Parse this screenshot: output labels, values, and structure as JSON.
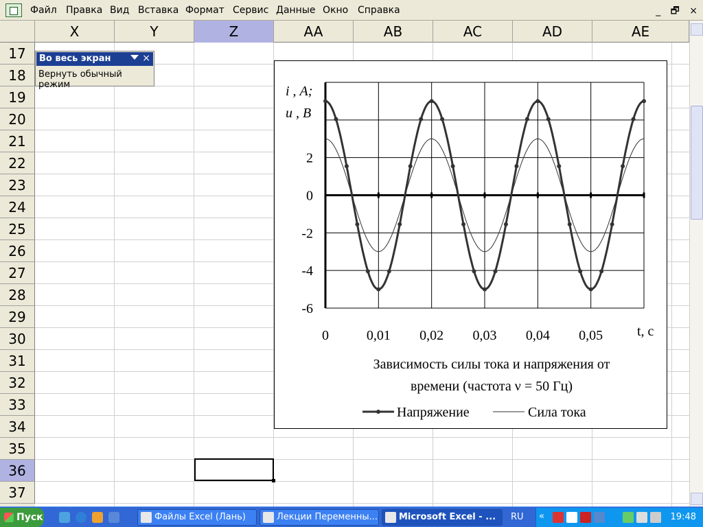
{
  "menu": [
    "Файл",
    "Правка",
    "Вид",
    "Вставка",
    "Формат",
    "Сервис",
    "Данные",
    "Окно",
    "Справка"
  ],
  "window_controls": {
    "minimize": "_",
    "restore": "🗗",
    "close": "×"
  },
  "columns": [
    {
      "label": "X",
      "selected": false
    },
    {
      "label": "Y",
      "selected": false
    },
    {
      "label": "Z",
      "selected": true
    },
    {
      "label": "AA",
      "selected": false
    },
    {
      "label": "AB",
      "selected": false
    },
    {
      "label": "AC",
      "selected": false
    },
    {
      "label": "AD",
      "selected": false
    },
    {
      "label": "AE",
      "selected": false
    }
  ],
  "rows": [
    "17",
    "18",
    "19",
    "20",
    "21",
    "22",
    "23",
    "24",
    "25",
    "26",
    "27",
    "28",
    "29",
    "30",
    "31",
    "32",
    "33",
    "34",
    "35",
    "36",
    "37"
  ],
  "selected_row": "36",
  "fullscreen_toolbar": {
    "title": "Во весь экран",
    "close": "×",
    "button": "Вернуть обычный режим"
  },
  "chart_data": {
    "type": "line",
    "ylabel_line1": "i , А;",
    "ylabel_line2": "u , В",
    "xlabel": "t, с",
    "title_line1": "Зависимость силы тока и напряжения от",
    "title_line2": "времени (частота ν  = 50 Гц)",
    "ylim": [
      -6,
      6
    ],
    "xlim": [
      0,
      0.06
    ],
    "yticks": [
      {
        "value": -6,
        "label": "-6"
      },
      {
        "value": -4,
        "label": "-4"
      },
      {
        "value": -2,
        "label": "-2"
      },
      {
        "value": 0,
        "label": "0"
      },
      {
        "value": 2,
        "label": "2"
      }
    ],
    "xticks": [
      {
        "value": 0,
        "label": "0"
      },
      {
        "value": 0.01,
        "label": "0,01"
      },
      {
        "value": 0.02,
        "label": "0,02"
      },
      {
        "value": 0.03,
        "label": "0,03"
      },
      {
        "value": 0.04,
        "label": "0,04"
      },
      {
        "value": 0.05,
        "label": "0,05"
      }
    ],
    "series": [
      {
        "name": "Напряжение",
        "amplitude": 5,
        "frequency_hz": 50,
        "markers": true,
        "color": "#333333"
      },
      {
        "name": "Сила тока",
        "amplitude": 3,
        "frequency_hz": 50,
        "markers": false,
        "color": "#333333"
      }
    ]
  },
  "taskbar": {
    "start": "Пуск",
    "tasks": [
      {
        "label": "Файлы Excel (Лань)",
        "active": false
      },
      {
        "label": "Лекции Переменны...",
        "active": false
      },
      {
        "label": "Microsoft Excel - ...",
        "active": true
      }
    ],
    "lang": "RU",
    "tray_arrow": "«",
    "clock": "19:48"
  }
}
